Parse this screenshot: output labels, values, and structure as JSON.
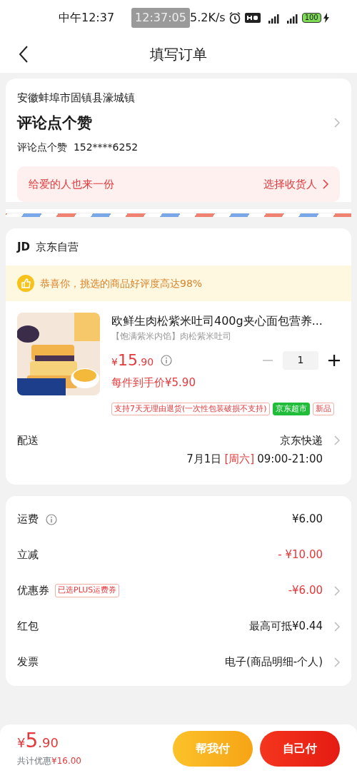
{
  "status_bar": {
    "time": "中午12:37",
    "recording_time": "12:37:05",
    "net_speed": "5.2K/s",
    "battery": "100"
  },
  "header": {
    "title": "填写订单"
  },
  "address": {
    "region": "安徽蚌埠市固镇县濠城镇",
    "name": "评论点个赞",
    "contact": "评论点个赞  152****6252",
    "gift_text": "给爱的人也来一份",
    "gift_action": "选择收货人"
  },
  "shop": {
    "logo": "JD",
    "name": "京东自营",
    "praise": "恭喜你，挑选的商品好评度高达98%"
  },
  "product": {
    "title": "欧鲜生肉松紫米吐司400g夹心面包营养...",
    "subtitle": "【饱满紫米内馅】肉松紫米吐司",
    "price_symbol": "¥",
    "price_int": "15",
    "price_dec": ".90",
    "quantity": "1",
    "minus_disabled": true,
    "unit_price": "每件到手价¥5.90",
    "tags": [
      {
        "text": "支持7天无理由退货(一次性包装破损不支持)",
        "kind": "outline"
      },
      {
        "text": "京东超市",
        "kind": "solid"
      },
      {
        "text": "新品",
        "kind": "outline"
      }
    ]
  },
  "delivery": {
    "label": "配送",
    "carrier": "京东快递",
    "date": "7月1日",
    "weekday": "[周六]",
    "time": "09:00-21:00"
  },
  "fees": [
    {
      "label": "运费",
      "info": true,
      "value": "¥6.00",
      "highlighted": false,
      "chevron": false
    },
    {
      "label": "立减",
      "info": false,
      "value": "- ¥10.00",
      "highlighted": true,
      "chevron": false
    },
    {
      "label": "优惠券",
      "info": false,
      "tag": "已选PLUS运费券",
      "value": "-¥6.00",
      "highlighted": true,
      "chevron": true
    },
    {
      "label": "红包",
      "info": false,
      "value": "最高可抵¥0.44",
      "highlighted": false,
      "chevron": true
    },
    {
      "label": "发票",
      "info": false,
      "value": "电子(商品明细-个人)",
      "highlighted": false,
      "chevron": true
    }
  ],
  "footer": {
    "total_symbol": "¥",
    "total_int": "5",
    "total_dec": ".90",
    "savings_label": "共计优惠",
    "savings": "¥16.00",
    "buttons": [
      {
        "label": "帮我付",
        "kind": "secondary"
      },
      {
        "label": "自己付",
        "kind": "primary"
      }
    ]
  }
}
